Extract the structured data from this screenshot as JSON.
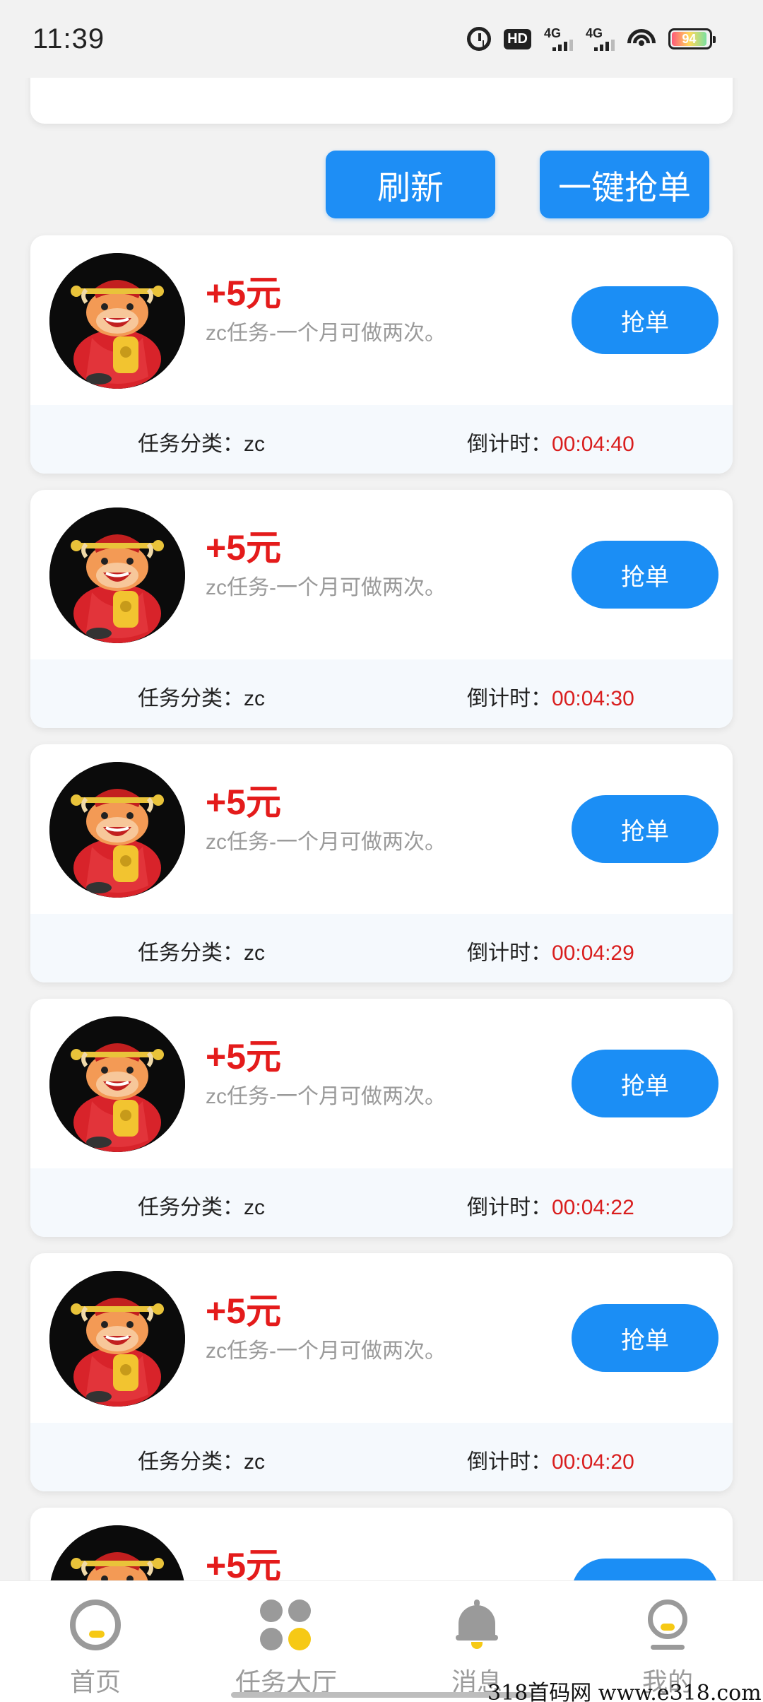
{
  "status_bar": {
    "time": "11:39",
    "hd_label": "HD",
    "sim1_label": "4G",
    "sim2_label": "4G",
    "battery": "94"
  },
  "actions": {
    "refresh_label": "刷新",
    "grab_all_label": "一键抢单"
  },
  "tasks": [
    {
      "reward": "+5元",
      "description": "zc任务-一个月可做两次。",
      "button": "抢单",
      "category_label": "任务分类：",
      "category": "zc",
      "countdown_label": "倒计时：",
      "countdown": "00:04:40"
    },
    {
      "reward": "+5元",
      "description": "zc任务-一个月可做两次。",
      "button": "抢单",
      "category_label": "任务分类：",
      "category": "zc",
      "countdown_label": "倒计时：",
      "countdown": "00:04:30"
    },
    {
      "reward": "+5元",
      "description": "zc任务-一个月可做两次。",
      "button": "抢单",
      "category_label": "任务分类：",
      "category": "zc",
      "countdown_label": "倒计时：",
      "countdown": "00:04:29"
    },
    {
      "reward": "+5元",
      "description": "zc任务-一个月可做两次。",
      "button": "抢单",
      "category_label": "任务分类：",
      "category": "zc",
      "countdown_label": "倒计时：",
      "countdown": "00:04:22"
    },
    {
      "reward": "+5元",
      "description": "zc任务-一个月可做两次。",
      "button": "抢单",
      "category_label": "任务分类：",
      "category": "zc",
      "countdown_label": "倒计时：",
      "countdown": "00:04:20"
    },
    {
      "reward": "+5元",
      "description": "",
      "button": "",
      "category_label": "",
      "category": "",
      "countdown_label": "",
      "countdown": ""
    }
  ],
  "bottom_nav": [
    {
      "label": "首页",
      "icon": "home-icon"
    },
    {
      "label": "任务大厅",
      "icon": "task-hall-icon"
    },
    {
      "label": "消息",
      "icon": "bell-icon"
    },
    {
      "label": "我的",
      "icon": "profile-icon"
    }
  ],
  "watermark": "318首码网  www.e318.com",
  "colors": {
    "accent_blue": "#1e8ef5",
    "reward_red": "#e41b1b",
    "countdown_red": "#d91e1e",
    "nav_highlight": "#f6c915"
  }
}
